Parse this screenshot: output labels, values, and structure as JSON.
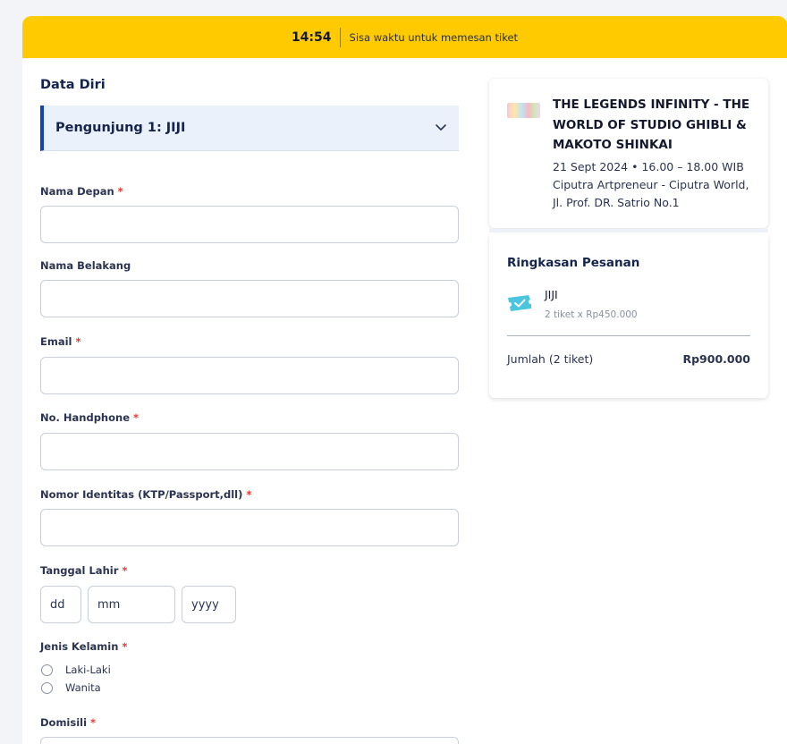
{
  "timer": {
    "time": "14:54",
    "text": "Sisa waktu untuk memesan tiket"
  },
  "form": {
    "section_title": "Data Diri",
    "accordion_title": "Pengunjung 1: JIJI",
    "required_mark": "*",
    "fields": {
      "first_name": {
        "label": "Nama Depan",
        "value": ""
      },
      "last_name": {
        "label": "Nama Belakang",
        "value": ""
      },
      "email": {
        "label": "Email",
        "value": ""
      },
      "phone": {
        "label": "No. Handphone",
        "value": ""
      },
      "identity": {
        "label": "Nomor Identitas (KTP/Passport,dll)",
        "value": ""
      },
      "birth_date": {
        "label": "Tanggal Lahir",
        "day_placeholder": "dd",
        "month_placeholder": "mm",
        "year_placeholder": "yyyy"
      },
      "gender": {
        "label": "Jenis Kelamin",
        "options": [
          "Laki-Laki",
          "Wanita"
        ]
      },
      "domicile": {
        "label": "Domisili",
        "value": ""
      }
    }
  },
  "event": {
    "title": "THE LEGENDS INFINITY - THE WORLD OF STUDIO GHIBLI & MAKOTO SHINKAI",
    "date_time": "21 Sept 2024 • 16.00 – 18.00 WIB",
    "venue": "Ciputra Artpreneur - Ciputra World, Jl. Prof. DR. Satrio No.1"
  },
  "summary": {
    "title": "Ringkasan Pesanan",
    "ticket_name": "JIJI",
    "ticket_qty": "2 tiket x Rp450.000",
    "total_label": "Jumlah (2 tiket)",
    "total_value": "Rp900.000"
  },
  "colors": {
    "timer_bar": "#ffcb00",
    "accent_blue": "#1442b8",
    "required_red": "#e53935",
    "ticket_icon": "#4cc6df"
  }
}
